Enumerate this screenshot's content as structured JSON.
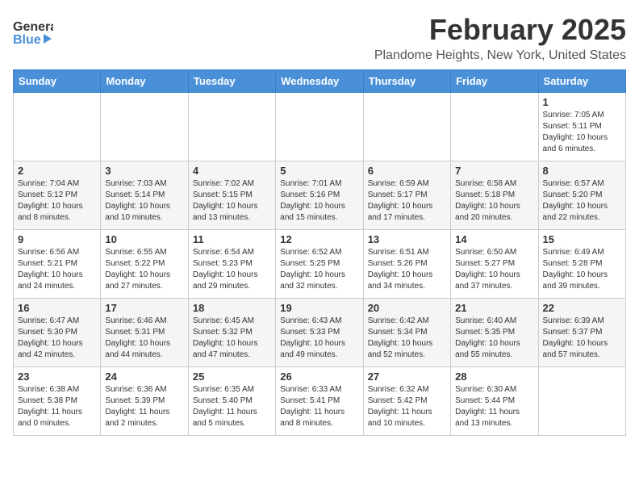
{
  "logo": {
    "line1": "General",
    "line2": "Blue"
  },
  "header": {
    "month": "February 2025",
    "location": "Plandome Heights, New York, United States"
  },
  "weekdays": [
    "Sunday",
    "Monday",
    "Tuesday",
    "Wednesday",
    "Thursday",
    "Friday",
    "Saturday"
  ],
  "weeks": [
    [
      {
        "day": "",
        "info": ""
      },
      {
        "day": "",
        "info": ""
      },
      {
        "day": "",
        "info": ""
      },
      {
        "day": "",
        "info": ""
      },
      {
        "day": "",
        "info": ""
      },
      {
        "day": "",
        "info": ""
      },
      {
        "day": "1",
        "info": "Sunrise: 7:05 AM\nSunset: 5:11 PM\nDaylight: 10 hours\nand 6 minutes."
      }
    ],
    [
      {
        "day": "2",
        "info": "Sunrise: 7:04 AM\nSunset: 5:12 PM\nDaylight: 10 hours\nand 8 minutes."
      },
      {
        "day": "3",
        "info": "Sunrise: 7:03 AM\nSunset: 5:14 PM\nDaylight: 10 hours\nand 10 minutes."
      },
      {
        "day": "4",
        "info": "Sunrise: 7:02 AM\nSunset: 5:15 PM\nDaylight: 10 hours\nand 13 minutes."
      },
      {
        "day": "5",
        "info": "Sunrise: 7:01 AM\nSunset: 5:16 PM\nDaylight: 10 hours\nand 15 minutes."
      },
      {
        "day": "6",
        "info": "Sunrise: 6:59 AM\nSunset: 5:17 PM\nDaylight: 10 hours\nand 17 minutes."
      },
      {
        "day": "7",
        "info": "Sunrise: 6:58 AM\nSunset: 5:18 PM\nDaylight: 10 hours\nand 20 minutes."
      },
      {
        "day": "8",
        "info": "Sunrise: 6:57 AM\nSunset: 5:20 PM\nDaylight: 10 hours\nand 22 minutes."
      }
    ],
    [
      {
        "day": "9",
        "info": "Sunrise: 6:56 AM\nSunset: 5:21 PM\nDaylight: 10 hours\nand 24 minutes."
      },
      {
        "day": "10",
        "info": "Sunrise: 6:55 AM\nSunset: 5:22 PM\nDaylight: 10 hours\nand 27 minutes."
      },
      {
        "day": "11",
        "info": "Sunrise: 6:54 AM\nSunset: 5:23 PM\nDaylight: 10 hours\nand 29 minutes."
      },
      {
        "day": "12",
        "info": "Sunrise: 6:52 AM\nSunset: 5:25 PM\nDaylight: 10 hours\nand 32 minutes."
      },
      {
        "day": "13",
        "info": "Sunrise: 6:51 AM\nSunset: 5:26 PM\nDaylight: 10 hours\nand 34 minutes."
      },
      {
        "day": "14",
        "info": "Sunrise: 6:50 AM\nSunset: 5:27 PM\nDaylight: 10 hours\nand 37 minutes."
      },
      {
        "day": "15",
        "info": "Sunrise: 6:49 AM\nSunset: 5:28 PM\nDaylight: 10 hours\nand 39 minutes."
      }
    ],
    [
      {
        "day": "16",
        "info": "Sunrise: 6:47 AM\nSunset: 5:30 PM\nDaylight: 10 hours\nand 42 minutes."
      },
      {
        "day": "17",
        "info": "Sunrise: 6:46 AM\nSunset: 5:31 PM\nDaylight: 10 hours\nand 44 minutes."
      },
      {
        "day": "18",
        "info": "Sunrise: 6:45 AM\nSunset: 5:32 PM\nDaylight: 10 hours\nand 47 minutes."
      },
      {
        "day": "19",
        "info": "Sunrise: 6:43 AM\nSunset: 5:33 PM\nDaylight: 10 hours\nand 49 minutes."
      },
      {
        "day": "20",
        "info": "Sunrise: 6:42 AM\nSunset: 5:34 PM\nDaylight: 10 hours\nand 52 minutes."
      },
      {
        "day": "21",
        "info": "Sunrise: 6:40 AM\nSunset: 5:35 PM\nDaylight: 10 hours\nand 55 minutes."
      },
      {
        "day": "22",
        "info": "Sunrise: 6:39 AM\nSunset: 5:37 PM\nDaylight: 10 hours\nand 57 minutes."
      }
    ],
    [
      {
        "day": "23",
        "info": "Sunrise: 6:38 AM\nSunset: 5:38 PM\nDaylight: 11 hours\nand 0 minutes."
      },
      {
        "day": "24",
        "info": "Sunrise: 6:36 AM\nSunset: 5:39 PM\nDaylight: 11 hours\nand 2 minutes."
      },
      {
        "day": "25",
        "info": "Sunrise: 6:35 AM\nSunset: 5:40 PM\nDaylight: 11 hours\nand 5 minutes."
      },
      {
        "day": "26",
        "info": "Sunrise: 6:33 AM\nSunset: 5:41 PM\nDaylight: 11 hours\nand 8 minutes."
      },
      {
        "day": "27",
        "info": "Sunrise: 6:32 AM\nSunset: 5:42 PM\nDaylight: 11 hours\nand 10 minutes."
      },
      {
        "day": "28",
        "info": "Sunrise: 6:30 AM\nSunset: 5:44 PM\nDaylight: 11 hours\nand 13 minutes."
      },
      {
        "day": "",
        "info": ""
      }
    ]
  ]
}
